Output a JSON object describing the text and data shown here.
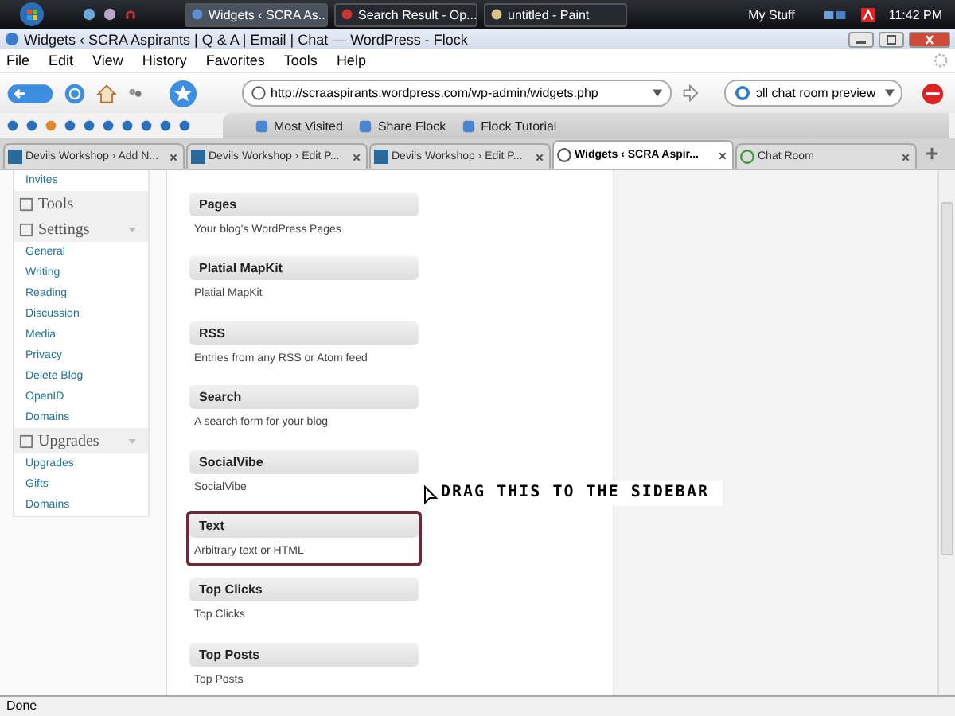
{
  "taskbar": {
    "buttons": [
      {
        "label": "Widgets ‹ SCRA As...",
        "selected": true
      },
      {
        "label": "Search Result - Op...",
        "selected": false
      },
      {
        "label": "untitled - Paint",
        "selected": false
      }
    ],
    "tray_label": "My Stuff",
    "clock": "11:42 PM"
  },
  "window": {
    "title": "Widgets ‹ SCRA Aspirants | Q & A | Email | Chat — WordPress - Flock"
  },
  "menu": [
    "File",
    "Edit",
    "View",
    "History",
    "Favorites",
    "Tools",
    "Help"
  ],
  "address": {
    "value": "http://scraaspirants.wordpress.com/wp-admin/widgets.php"
  },
  "search": {
    "value": "ɔll chat room preview"
  },
  "bookmarks": [
    "Most Visited",
    "Share Flock",
    "Flock Tutorial"
  ],
  "tabs": [
    {
      "label": "Devils Workshop › Add N...",
      "selected": false
    },
    {
      "label": "Devils Workshop › Edit P...",
      "selected": false
    },
    {
      "label": "Devils Workshop › Edit P...",
      "selected": false
    },
    {
      "label": "Widgets ‹ SCRA Aspir...",
      "selected": true
    },
    {
      "label": "Chat Room",
      "selected": false
    }
  ],
  "sidebar": [
    {
      "kind": "item",
      "label": "Invites"
    },
    {
      "kind": "section",
      "label": "Tools",
      "collapsible": false
    },
    {
      "kind": "section",
      "label": "Settings",
      "collapsible": true
    },
    {
      "kind": "item",
      "label": "General"
    },
    {
      "kind": "item",
      "label": "Writing"
    },
    {
      "kind": "item",
      "label": "Reading"
    },
    {
      "kind": "item",
      "label": "Discussion"
    },
    {
      "kind": "item",
      "label": "Media"
    },
    {
      "kind": "item",
      "label": "Privacy"
    },
    {
      "kind": "item",
      "label": "Delete Blog"
    },
    {
      "kind": "item",
      "label": "OpenID"
    },
    {
      "kind": "item",
      "label": "Domains"
    },
    {
      "kind": "section",
      "label": "Upgrades",
      "collapsible": true
    },
    {
      "kind": "item",
      "label": "Upgrades"
    },
    {
      "kind": "item",
      "label": "Gifts"
    },
    {
      "kind": "item",
      "label": "Domains"
    }
  ],
  "widgets": [
    {
      "title": "Pages",
      "description": "Your blog's WordPress Pages",
      "highlighted": false
    },
    {
      "title": "Platial MapKit",
      "description": "Platial MapKit",
      "highlighted": false
    },
    {
      "title": "RSS",
      "description": "Entries from any RSS or Atom feed",
      "highlighted": false
    },
    {
      "title": "Search",
      "description": "A search form for your blog",
      "highlighted": false
    },
    {
      "title": "SocialVibe",
      "description": "SocialVibe",
      "highlighted": false
    },
    {
      "title": "Text",
      "description": "Arbitrary text or HTML",
      "highlighted": true
    },
    {
      "title": "Top Clicks",
      "description": "Top Clicks",
      "highlighted": false
    },
    {
      "title": "Top Posts",
      "description": "Top Posts",
      "highlighted": false
    }
  ],
  "annotation": "DRAG THIS TO THE SIDEBAR",
  "status_bar": "Done"
}
